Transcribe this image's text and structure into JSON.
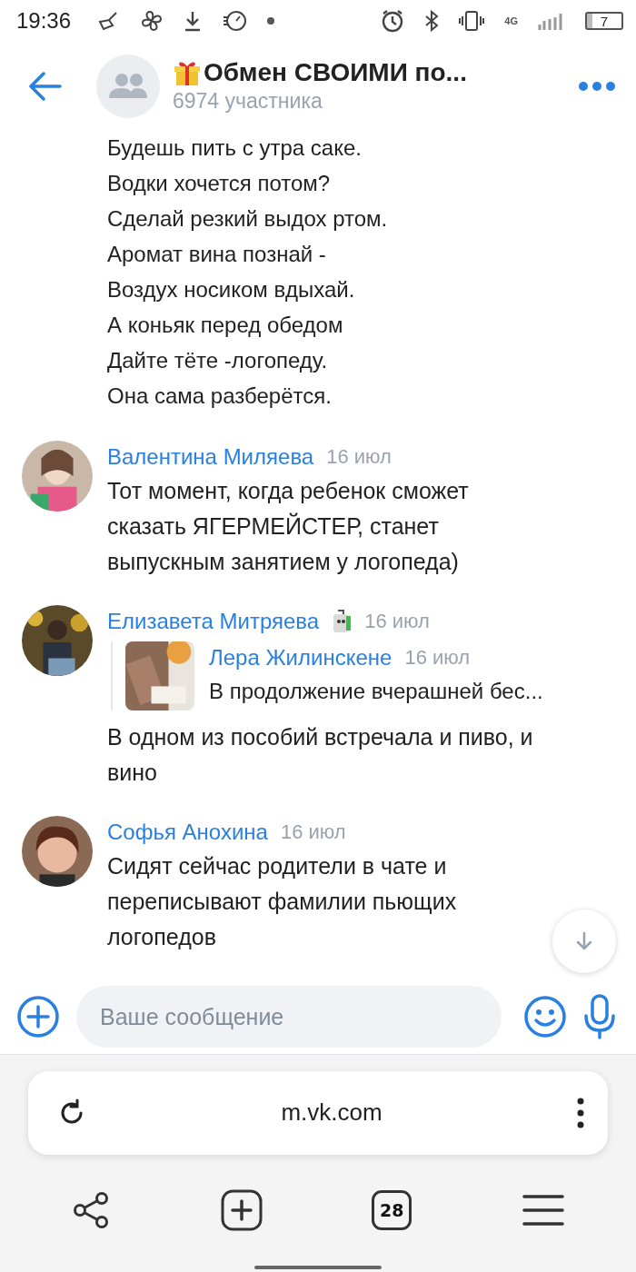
{
  "status_bar": {
    "time": "19:36",
    "network": "4G",
    "battery": "7"
  },
  "header": {
    "title": "Обмен СВОИМИ по...",
    "subtitle": "6974 участника"
  },
  "messages": [
    {
      "kind": "continuation",
      "lines": [
        "Будешь пить с утра саке.",
        "Водки хочется потом?",
        "Сделай резкий выдох ртом.",
        "Аромат вина познай -",
        "Воздух носиком вдыхай.",
        "А коньяк перед обедом",
        "Дайте тёте -логопеду.",
        "Она сама разберётся."
      ]
    },
    {
      "kind": "message",
      "author": "Валентина Миляева",
      "badge": false,
      "date": "16 июл",
      "text": "Тот момент, когда ребенок сможет сказать ЯГЕРМЕЙСТЕР, станет выпускным занятием у логопеда)"
    },
    {
      "kind": "message",
      "author": "Елизавета Митряева",
      "badge": true,
      "date": "16 июл",
      "reply": {
        "author": "Лера Жилинскене",
        "date": "16 июл",
        "text": "В продолжение вчерашней бес..."
      },
      "text": "В одном из пособий встречала и пиво, и вино"
    },
    {
      "kind": "message",
      "author": "Софья Анохина",
      "badge": false,
      "date": "16 июл",
      "text": "Сидят сейчас родители в чате и переписывают фамилии пьющих логопедов"
    }
  ],
  "composer": {
    "placeholder": "Ваше сообщение"
  },
  "browser": {
    "url": "m.vk.com",
    "tab_count": "28"
  }
}
